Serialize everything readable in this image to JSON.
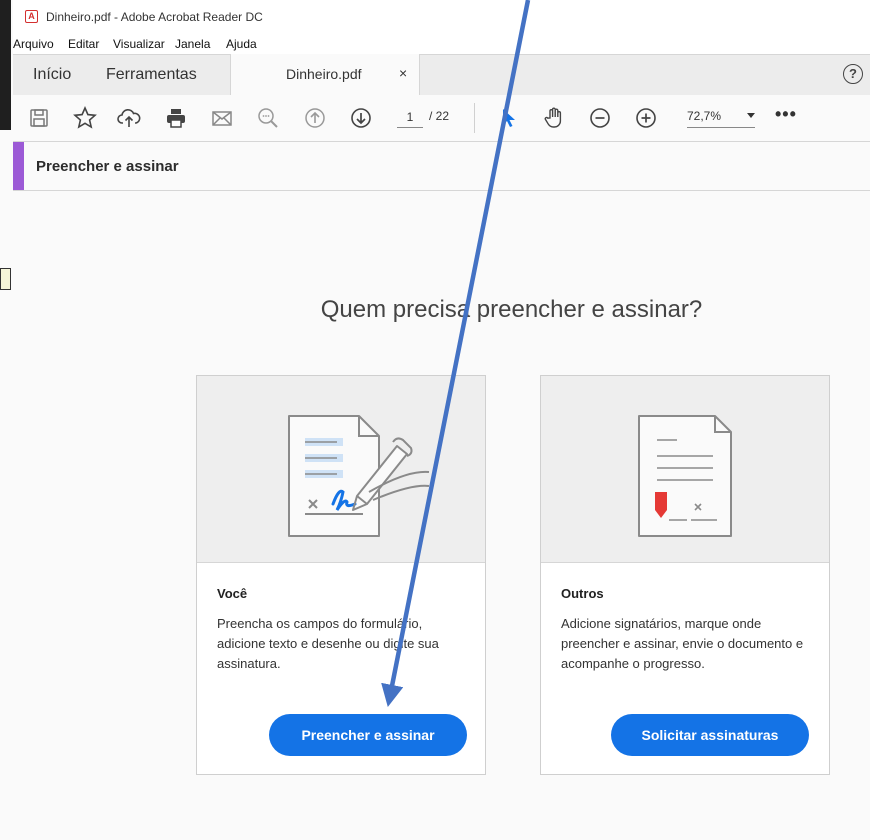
{
  "window": {
    "title": "Dinheiro.pdf - Adobe Acrobat Reader DC"
  },
  "menu": [
    "Arquivo",
    "Editar",
    "Visualizar",
    "Janela",
    "Ajuda"
  ],
  "tabs": {
    "home": "Início",
    "tools": "Ferramentas",
    "document": "Dinheiro.pdf",
    "close": "×",
    "help": "?"
  },
  "toolbar": {
    "page_current": "1",
    "page_total": "/ 22",
    "zoom": "72,7%",
    "more": "•••"
  },
  "tool_panel": {
    "name": "Preencher e assinar",
    "accent_color": "#9c5ad6"
  },
  "main": {
    "heading": "Quem precisa preencher e assinar?",
    "cards": [
      {
        "title": "Você",
        "description": "Preencha os campos do formulário, adicione texto e desenhe ou digite sua assinatura.",
        "button": "Preencher e assinar"
      },
      {
        "title": "Outros",
        "description": "Adicione signatários, marque onde preencher e assinar, envie o documento e acompanhe o progresso.",
        "button": "Solicitar assinaturas"
      }
    ]
  },
  "colors": {
    "primary_button": "#1473e6",
    "annotation_arrow": "#4472c4"
  },
  "icons": [
    "pdf-icon",
    "save-icon",
    "star-icon",
    "upload-icon",
    "print-icon",
    "mail-icon",
    "zoom-search-icon",
    "page-up-icon",
    "page-down-icon",
    "select-arrow-icon",
    "hand-icon",
    "zoom-out-icon",
    "zoom-in-icon",
    "more-icon",
    "help-icon",
    "document-sign-icon",
    "document-request-icon"
  ]
}
